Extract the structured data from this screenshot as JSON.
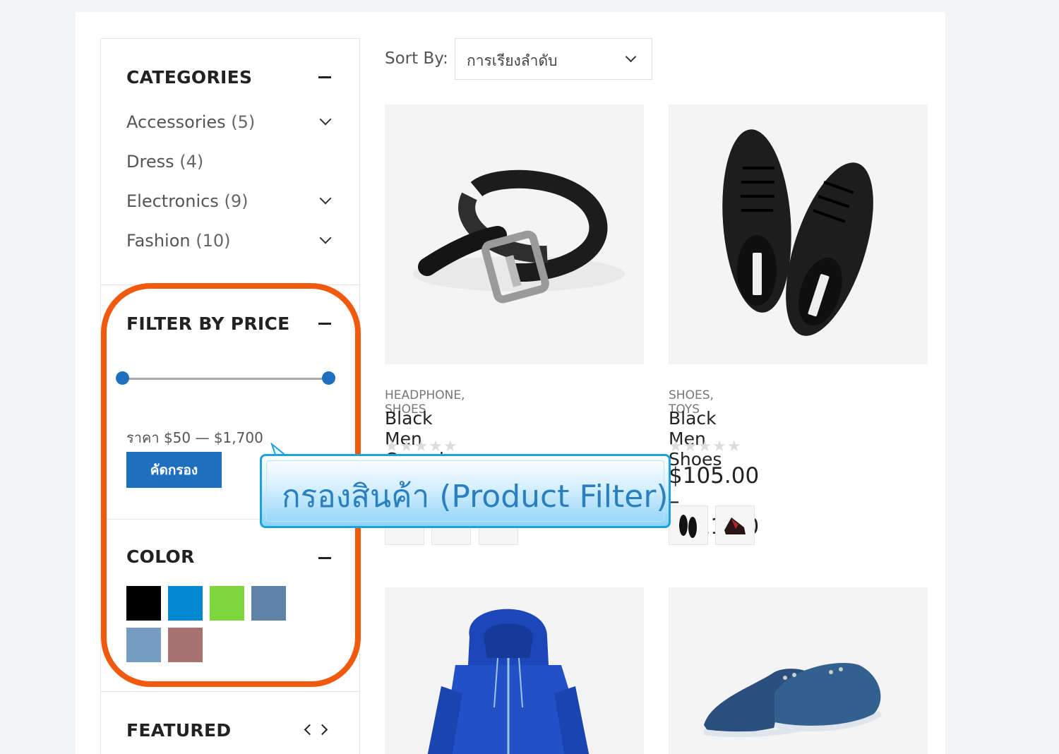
{
  "sidebar": {
    "categories": {
      "title": "CATEGORIES",
      "items": [
        {
          "name": "Accessories",
          "count": "(5)",
          "expandable": true
        },
        {
          "name": "Dress",
          "count": "(4)",
          "expandable": false
        },
        {
          "name": "Electronics",
          "count": "(9)",
          "expandable": true
        },
        {
          "name": "Fashion",
          "count": "(10)",
          "expandable": true
        }
      ]
    },
    "price_filter": {
      "title": "FILTER BY PRICE",
      "range_min": 0,
      "range_max": 1,
      "price_label": "ราคา $50 — $1,700",
      "button_label": "คัดกรอง"
    },
    "color": {
      "title": "COLOR",
      "swatches": [
        "#000000",
        "#0388d1",
        "#7fd63c",
        "#5f83a6",
        "#769dc1",
        "#a87272"
      ]
    },
    "featured": {
      "title": "FEATURED"
    }
  },
  "toolbar": {
    "sort_label": "Sort By:",
    "sort_value": "การเรียงลำดับ"
  },
  "products": [
    {
      "categories": "HEADPHONE, SHOES",
      "title": "Black Men Casual Belt",
      "rating": 0,
      "price": "",
      "image": "belt"
    },
    {
      "categories": "SHOES, TOYS",
      "title": "Black Men Shoes",
      "rating": 0,
      "price": "$105.00 – $111.00",
      "image": "black-shoes"
    },
    {
      "categories": "",
      "title": "",
      "rating": 0,
      "price": "",
      "image": "blue-hoodie"
    },
    {
      "categories": "",
      "title": "",
      "rating": 0,
      "price": "",
      "image": "blue-shoes"
    }
  ],
  "callout": {
    "text": "กรองสินค้า (Product Filter)"
  },
  "colors": {
    "accent": "#1f6fbf",
    "highlight": "#f05a0e",
    "callout_border": "#1ea2dc"
  }
}
